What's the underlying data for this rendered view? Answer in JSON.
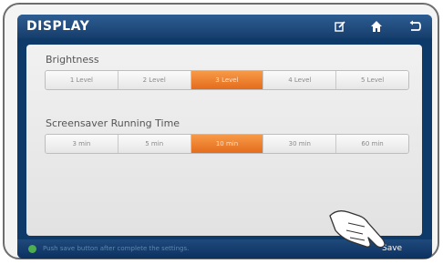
{
  "header": {
    "title": "DISPLAY",
    "icons": [
      "edit-icon",
      "home-icon",
      "back-icon"
    ]
  },
  "brightness": {
    "label": "Brightness",
    "options": [
      "1 Level",
      "2 Level",
      "3 Level",
      "4 Level",
      "5 Level"
    ],
    "selected": "3 Level"
  },
  "screensaver": {
    "label": "Screensaver Running Time",
    "options": [
      "3 min",
      "5 min",
      "10 min",
      "30 min",
      "60 min"
    ],
    "selected": "10 min"
  },
  "footer": {
    "hint": "Push save button after complete the settings.",
    "save_label": "Save"
  },
  "colors": {
    "accent": "#e8752a",
    "header": "#1e4a7c"
  }
}
